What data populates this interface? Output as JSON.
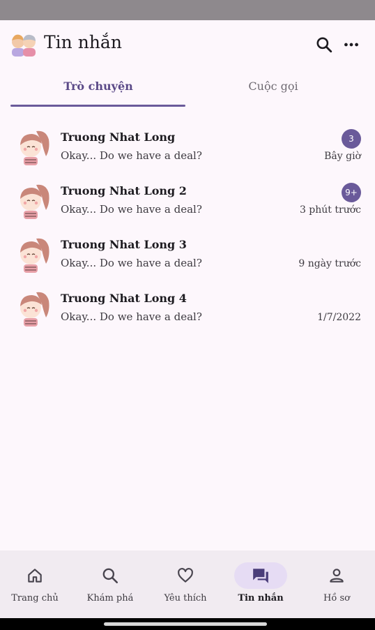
{
  "header": {
    "title": "Tin nhắn",
    "logo_icon": "couple-avatar-icon"
  },
  "tabs": [
    {
      "label": "Trò chuyện",
      "active": true
    },
    {
      "label": "Cuộc gọi",
      "active": false
    }
  ],
  "conversations": [
    {
      "name": "Truong Nhat Long",
      "message": "Okay... Do we have a deal?",
      "time": "Bây giờ",
      "unread": "3"
    },
    {
      "name": "Truong Nhat Long 2",
      "message": "Okay... Do we have a deal?",
      "time": "3 phút trước",
      "unread": "9+"
    },
    {
      "name": "Truong Nhat Long 3",
      "message": "Okay... Do we have a deal?",
      "time": "9 ngày trước",
      "unread": ""
    },
    {
      "name": "Truong Nhat Long 4",
      "message": "Okay... Do we have a deal?",
      "time": "1/7/2022",
      "unread": ""
    }
  ],
  "bottom_nav": [
    {
      "label": "Trang chủ",
      "icon": "home-icon",
      "active": false
    },
    {
      "label": "Khám phá",
      "icon": "search-icon",
      "active": false
    },
    {
      "label": "Yêu thích",
      "icon": "heart-icon",
      "active": false
    },
    {
      "label": "Tin nhắn",
      "icon": "chat-icon",
      "active": true
    },
    {
      "label": "Hồ sơ",
      "icon": "person-icon",
      "active": false
    }
  ],
  "colors": {
    "accent": "#6a5a9a",
    "background": "#fdf7fc",
    "nav_background": "#f1ebf1"
  }
}
